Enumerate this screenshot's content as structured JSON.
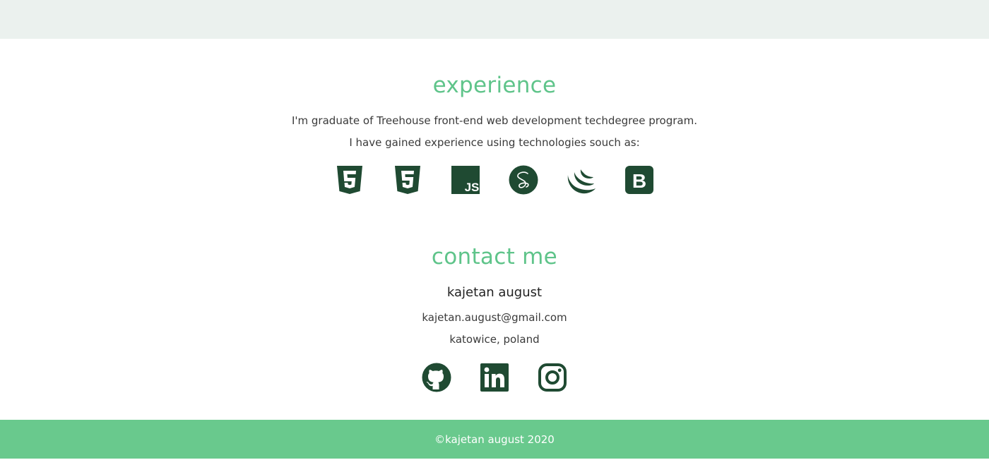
{
  "experience": {
    "title": "experience",
    "line1": "I'm graduate of Treehouse front-end web development techdegree program.",
    "line2": "I have gained experience using technologies souch as:",
    "tech_icons": [
      "html5-icon",
      "css3-icon",
      "javascript-icon",
      "sass-icon",
      "jquery-icon",
      "bootstrap-icon"
    ]
  },
  "contact": {
    "title": "contact me",
    "name": "kajetan august",
    "email": "kajetan.august@gmail.com",
    "location": "katowice, poland",
    "social_icons": [
      "github-icon",
      "linkedin-icon",
      "instagram-icon"
    ]
  },
  "footer": {
    "text": "©kajetan august 2020"
  },
  "colors": {
    "accent": "#5fc48a",
    "footer_bg": "#69c98d",
    "icon": "#1f4a32",
    "top_band": "#ebf1ee"
  }
}
